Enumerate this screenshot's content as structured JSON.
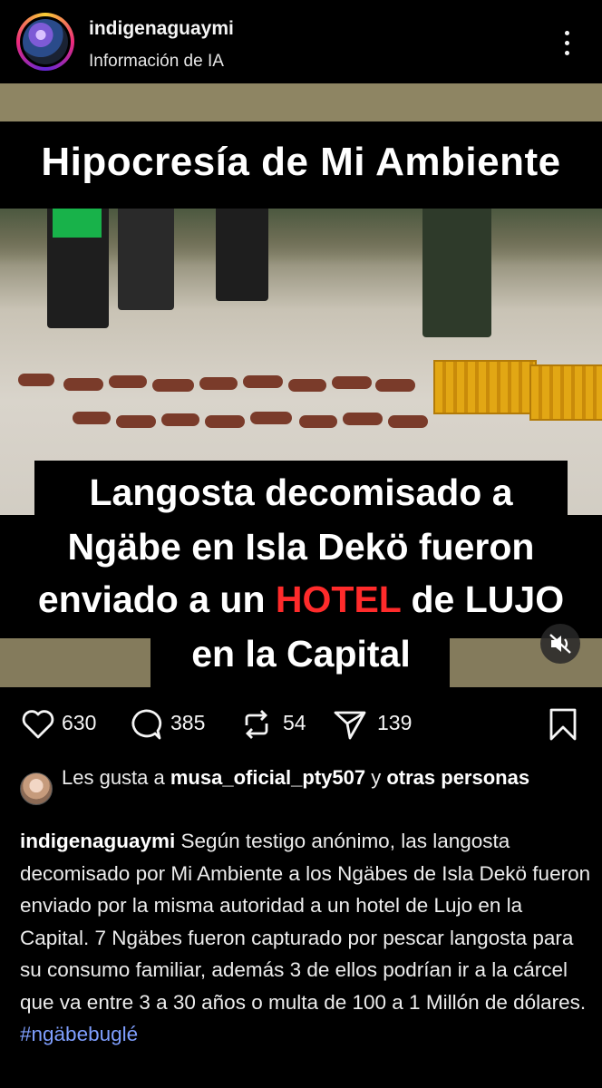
{
  "post": {
    "username": "indigenaguaymi",
    "subtitle": "Información de IA",
    "more_icon": "more-vertical-icon"
  },
  "media": {
    "title": "Hipocresía de Mi Ambiente",
    "caption_line1": "Langosta decomisado a",
    "caption_line2": "Ngäbe en Isla Dekö fueron",
    "caption_line3_pre": "enviado a un ",
    "caption_line3_highlight": "HOTEL",
    "caption_line3_post": " de LUJO",
    "caption_line4": "en la Capital",
    "highlight_color": "#ff2b2b",
    "mute_icon": "volume-off-icon"
  },
  "actions": {
    "likes": "630",
    "comments": "385",
    "reposts": "54",
    "shares": "139"
  },
  "likes_line": {
    "prefix": "Les gusta a ",
    "user": "musa_oficial_pty507",
    "middle": " y ",
    "others": "otras personas"
  },
  "caption": {
    "username": "indigenaguaymi",
    "text": " Según testigo anónimo, las langosta decomisado por Mi Ambiente a los Ngäbes de Isla Dekö fueron enviado por la misma autoridad a un hotel de Lujo en la Capital.  7 Ngäbes fueron capturado por pescar langosta para su consumo familiar, además 3 de ellos podrían ir a la cárcel que va entre 3 a 30 años o multa de 100 a 1 Millón de dólares. ",
    "hashtag": "#ngäbebuglé",
    "hashtag_color": "#7f9fff"
  }
}
